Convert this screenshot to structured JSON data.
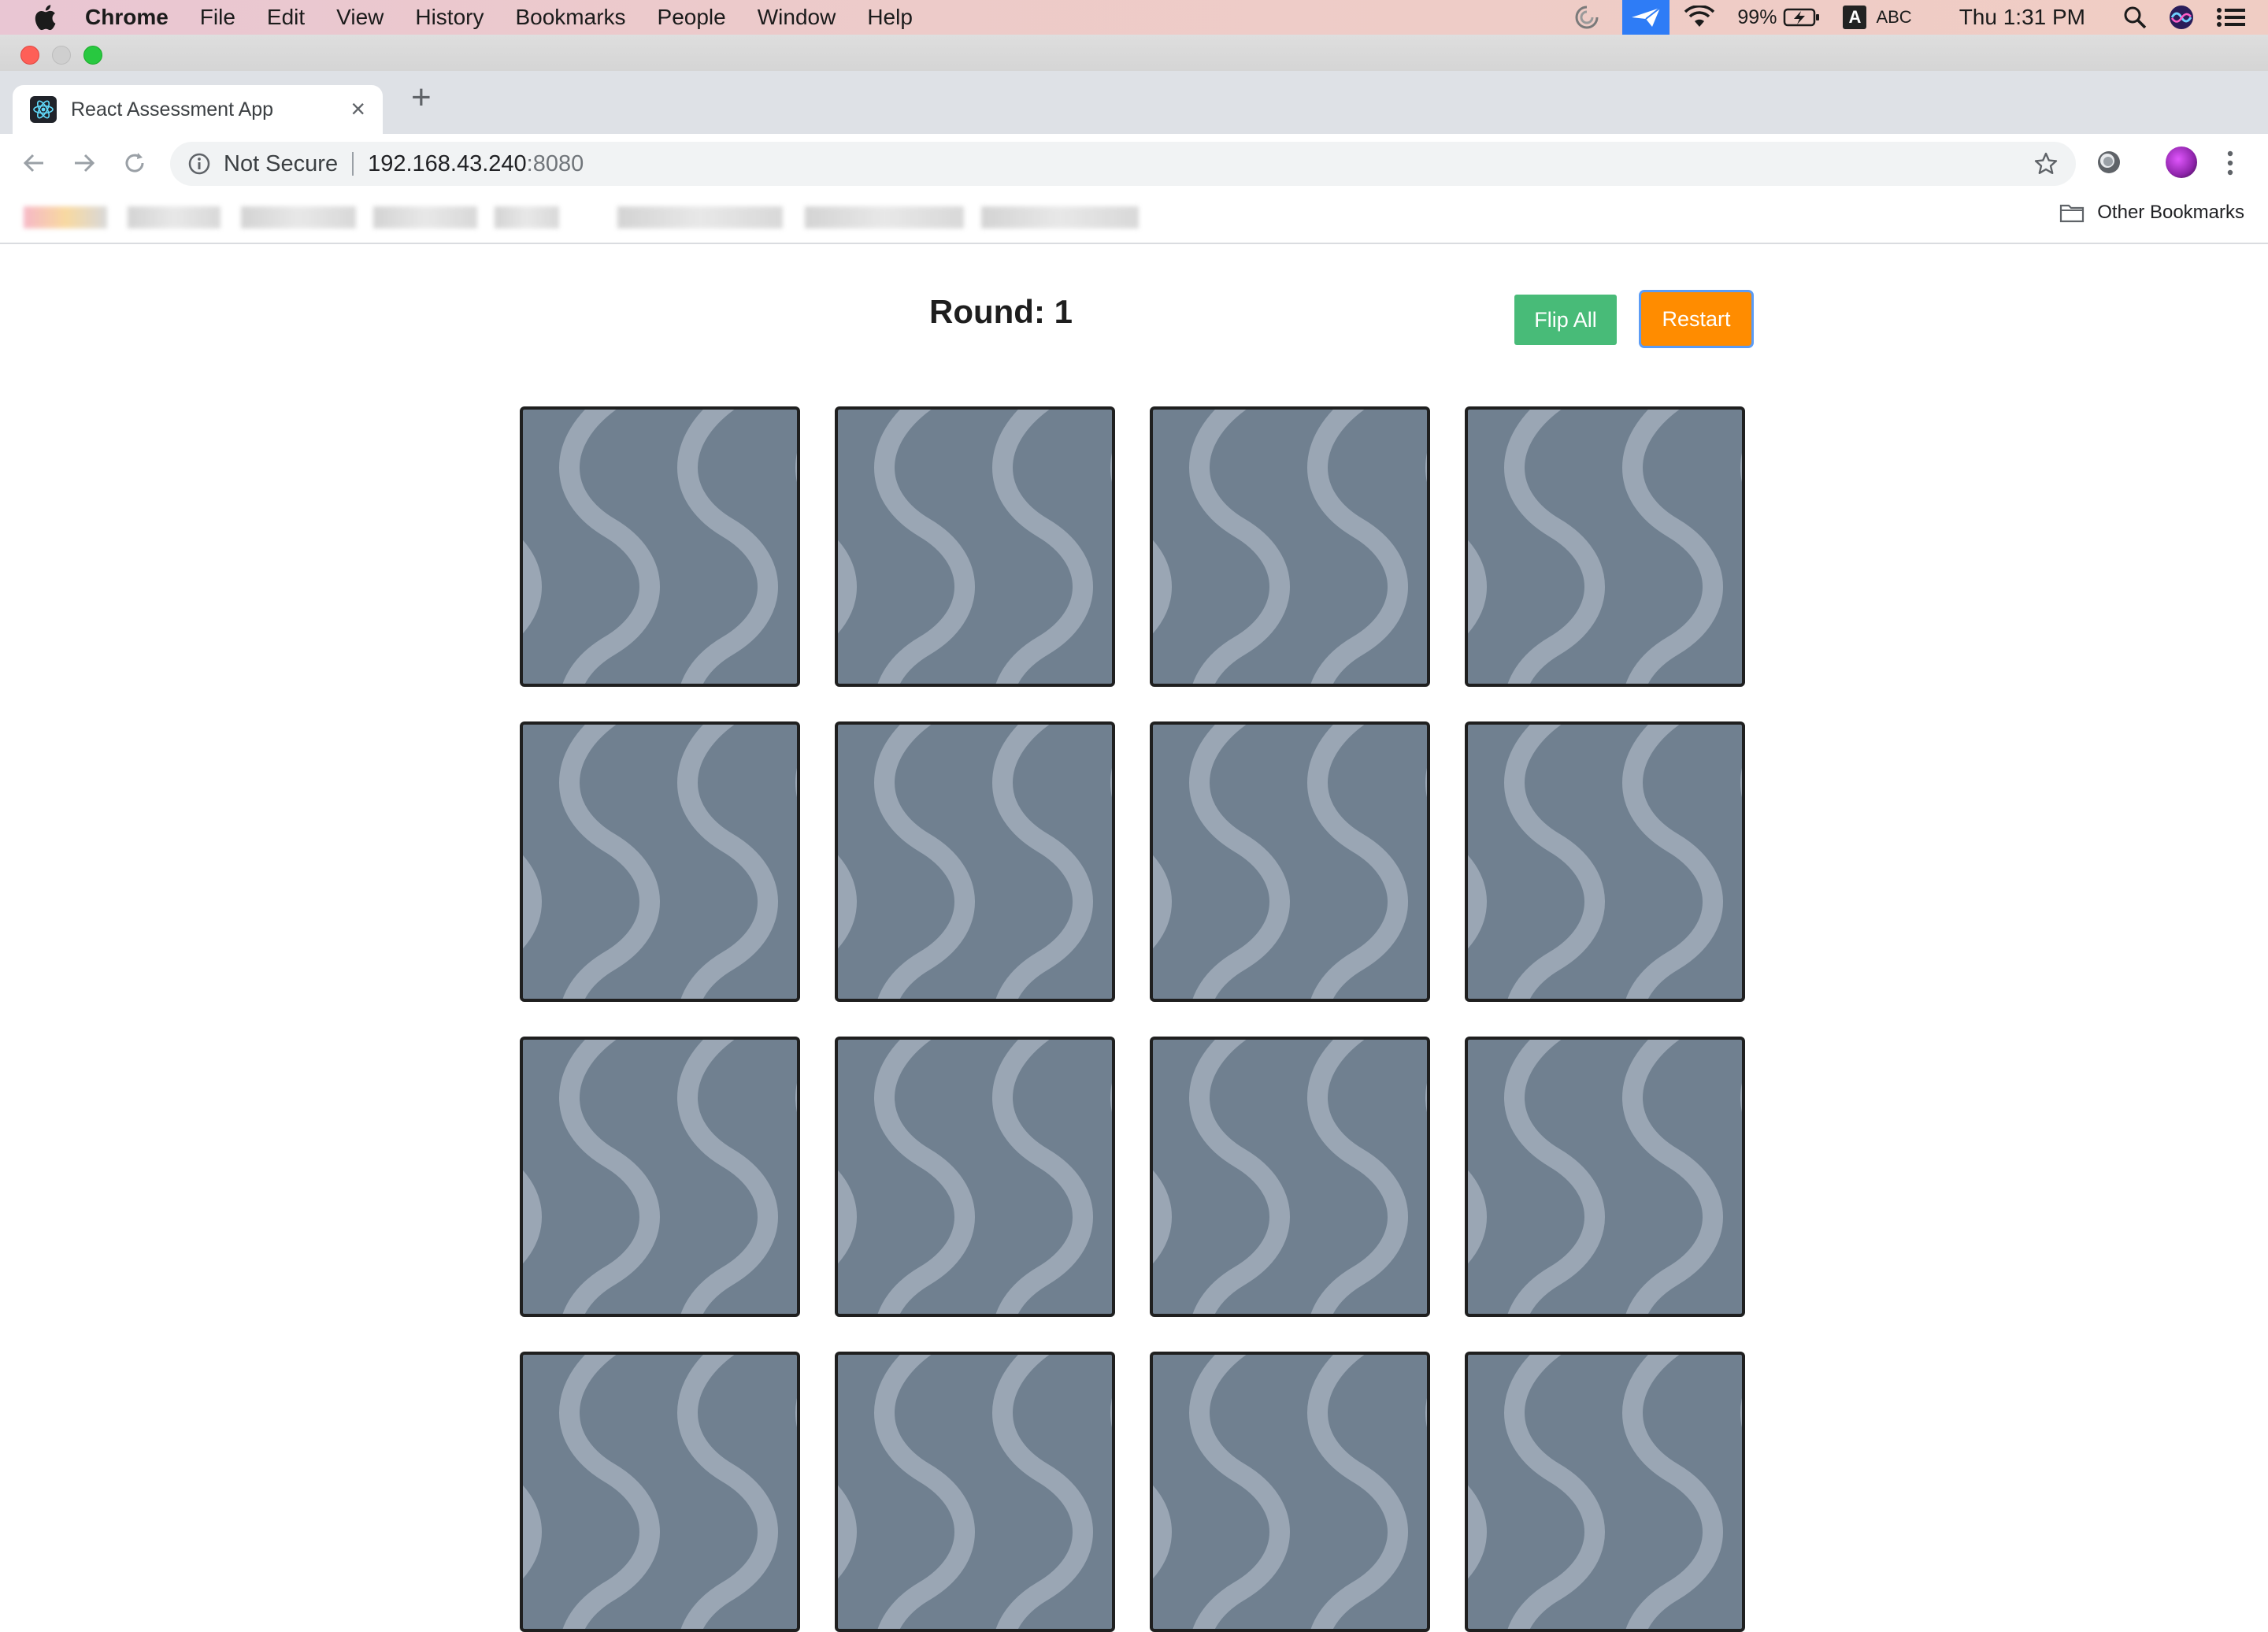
{
  "menubar": {
    "app": "Chrome",
    "items": [
      "File",
      "Edit",
      "View",
      "History",
      "Bookmarks",
      "People",
      "Window",
      "Help"
    ],
    "battery": "99%",
    "input_source": "ABC",
    "input_badge": "A",
    "clock": "Thu 1:31 PM"
  },
  "browser": {
    "tab_title": "React Assessment App",
    "new_tab": "+",
    "close_tab": "×",
    "security_label": "Not Secure",
    "url_host": "192.168.43.240",
    "url_port": ":8080",
    "other_bookmarks": "Other Bookmarks"
  },
  "app": {
    "round_label": "Round: 1",
    "flip_all_label": "Flip All",
    "restart_label": "Restart",
    "card_count": 16,
    "card_face": "face-down"
  },
  "colors": {
    "card_back": "#708090",
    "card_pattern": "#9aa6b4",
    "flip_button": "#48bb78",
    "restart_button": "#ff8c00"
  }
}
